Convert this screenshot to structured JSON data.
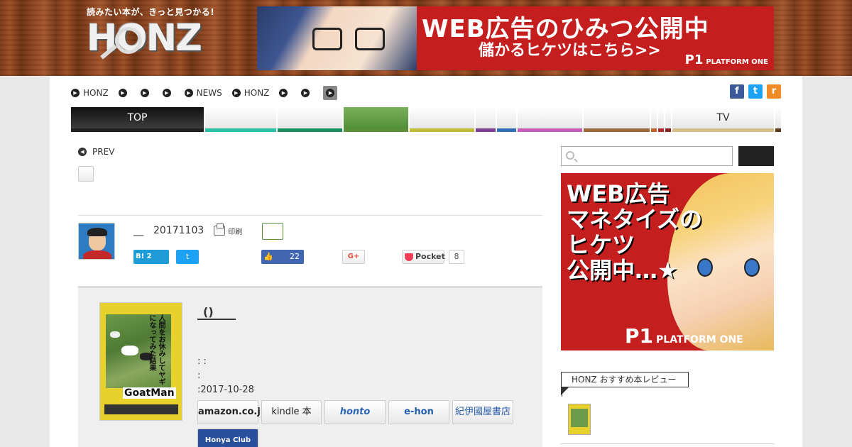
{
  "header": {
    "logo_tagline": "読みたい本が、きっと見つかる!",
    "logo_wordmark": "HONZ",
    "top_banner": {
      "line1": "WEB広告のひみつ公開中",
      "line2": "儲かるヒケツはこちら>>",
      "brand_mark": "P1",
      "brand_name": "PLATFORM ONE"
    }
  },
  "breadcrumb": {
    "items": [
      "HONZ",
      "",
      "",
      "",
      "NEWS",
      "HONZ",
      "",
      ""
    ],
    "bullet_glyph": "▶"
  },
  "social_top": {
    "facebook": "f",
    "twitter": "t",
    "rss": "r"
  },
  "catnav": {
    "items": [
      {
        "label": "TOP",
        "color": "#222222"
      },
      {
        "label": "",
        "color": "#2bbfa5"
      },
      {
        "label": "",
        "color": "#1a8f5e"
      },
      {
        "label": "",
        "color": "#5b8f3a"
      },
      {
        "label": "",
        "color": "#c2bb3a"
      },
      {
        "label": "",
        "color": "#7b3f8f"
      },
      {
        "label": "",
        "color": "#2f6fb3"
      },
      {
        "label": "",
        "color": "#c95bb8"
      },
      {
        "label": "",
        "color": "#9b6a3a"
      },
      {
        "label": "",
        "color": "#c0622a"
      },
      {
        "label": "",
        "color": "#b52a2a"
      },
      {
        "label": "",
        "color": "#8a1f1f"
      },
      {
        "label": "TV",
        "color": "#d8c08a"
      },
      {
        "label": "",
        "color": "#5a3a1a"
      }
    ]
  },
  "article": {
    "prev_label": "PREV",
    "author_name": "__",
    "date": "20171103",
    "print_label": "印刷",
    "share": {
      "hatena_label": "B!",
      "hatena_count": "2",
      "twitter_glyph": "t",
      "facebook_count": "22",
      "facebook_glyph": "👍",
      "gplus_label": "G+",
      "pocket_label": "Pocket",
      "pocket_count": "8"
    },
    "book": {
      "title": "()",
      "cover_title_jp": "人間をお休みしてヤギになってみた結果",
      "cover_author": "トーマス・トウェイツ",
      "cover_title_en": "GoatMan",
      "meta_line1": ": :",
      "meta_line2": ":",
      "meta_line3": ":2017-10-28",
      "stores": [
        {
          "label": "amazon.co.jp"
        },
        {
          "label": "kindle 本"
        },
        {
          "label": "honto"
        },
        {
          "label": "e-hon"
        },
        {
          "label": "紀伊國屋書店"
        },
        {
          "label": "Honya Club"
        }
      ]
    }
  },
  "sidebar": {
    "search_placeholder": "",
    "search_button_label": "",
    "banner": {
      "line1": "WEB広告",
      "line2": "マネタイズの",
      "line3": "ヒケツ",
      "line4": "公開中…★",
      "brand_mark": "P1",
      "brand_name": "PLATFORM ONE"
    },
    "reco_heading": "HONZ おすすめ本レビュー"
  }
}
